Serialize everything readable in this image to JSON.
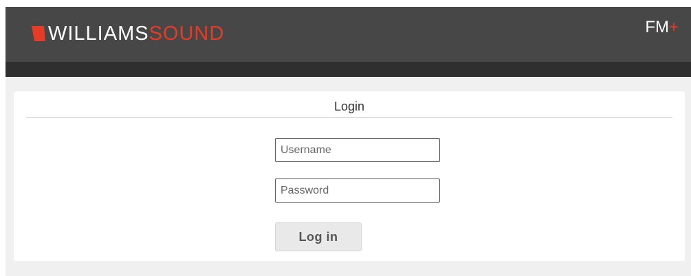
{
  "header": {
    "logo_text_primary": "WILLIAMS",
    "logo_text_secondary": "SOUND",
    "product_name": "FM",
    "product_suffix": "+",
    "brand_color": "#e63b26",
    "header_color": "#474747"
  },
  "login": {
    "title": "Login",
    "username_placeholder": "Username",
    "username_value": "",
    "password_placeholder": "Password",
    "password_value": "",
    "submit_label": "Log in"
  }
}
